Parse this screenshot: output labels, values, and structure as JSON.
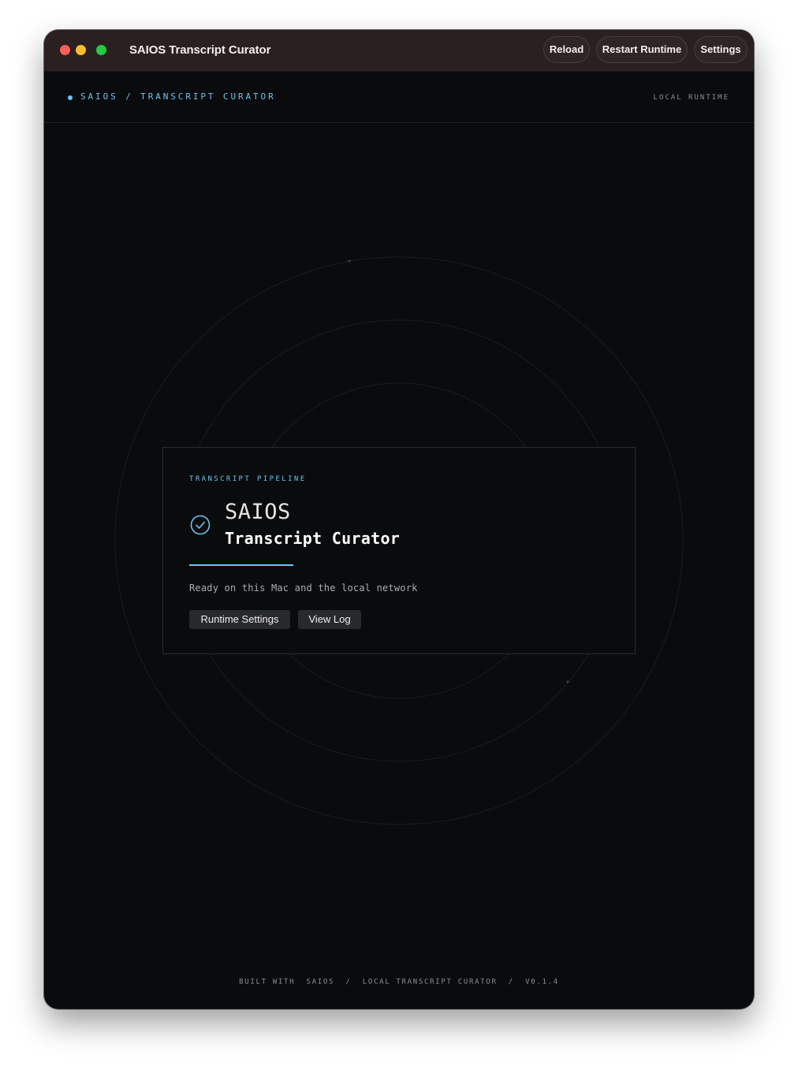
{
  "window": {
    "title": "SAIOS Transcript Curator",
    "toolbar": {
      "reload_label": "Reload",
      "restart_label": "Restart Runtime",
      "settings_label": "Settings"
    }
  },
  "header": {
    "breadcrumb": "SAIOS / TRANSCRIPT CURATOR",
    "runtime_label": "LOCAL RUNTIME"
  },
  "card": {
    "eyebrow": "TRANSCRIPT PIPELINE",
    "title_line1": "SAIOS",
    "title_line2": "Transcript Curator",
    "status": "Ready on this Mac and the local network",
    "buttons": {
      "runtime_settings": "Runtime Settings",
      "view_log": "View Log"
    },
    "icon": "check-circle-icon"
  },
  "footer": {
    "text": "BUILT WITH  SAIOS  /  LOCAL TRANSCRIPT CURATOR  /  V0.1.4"
  },
  "colors": {
    "accent": "#6cc4ee",
    "background": "#0a0b0d",
    "titlebar": "#2a201f"
  }
}
